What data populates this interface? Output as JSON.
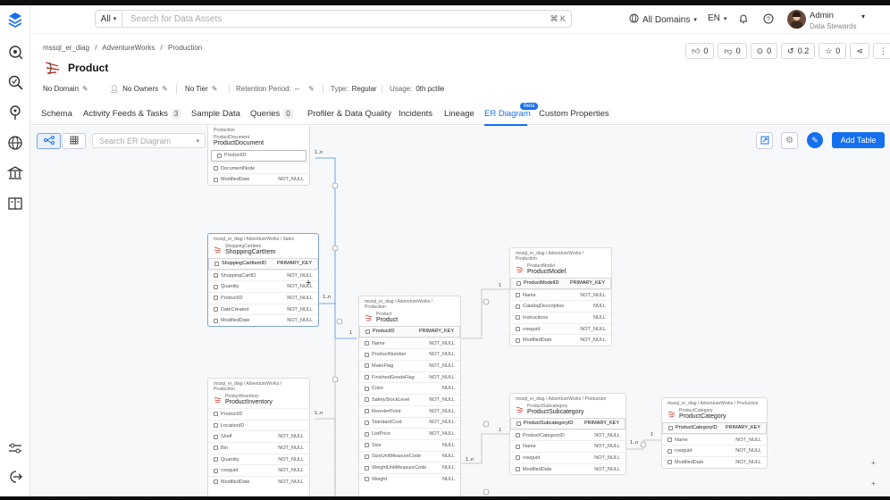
{
  "topbar": {
    "search_scope": "All",
    "search_placeholder": "Search for Data Assets",
    "shortcut": "⌘ K",
    "domain": "All Domains",
    "language": "EN",
    "user_name": "Admin",
    "user_role": "Data Stewards"
  },
  "breadcrumb": {
    "a": "mssql_er_diag",
    "sep1": "/",
    "b": "AdventureWorks",
    "sep2": "/",
    "c": "Production"
  },
  "entity": {
    "title": "Product"
  },
  "actions": {
    "thumbs_up": "0",
    "thumbs_down": "0",
    "conversations": "0",
    "version": "0.2",
    "stars": "0"
  },
  "meta": {
    "domain": "No Domain",
    "owners": "No Owners",
    "tier": "No Tier",
    "retention_label": "Retention Period:",
    "retention_value": "--",
    "type_label": "Type:",
    "type_value": "Regular",
    "usage_label": "Usage:",
    "usage_value": "0th pctile"
  },
  "tabs": [
    {
      "label": "Schema"
    },
    {
      "label": "Activity Feeds & Tasks",
      "count": "3"
    },
    {
      "label": "Sample Data"
    },
    {
      "label": "Queries",
      "count": "0"
    },
    {
      "label": "Profiler & Data Quality"
    },
    {
      "label": "Incidents"
    },
    {
      "label": "Lineage"
    },
    {
      "label": "ER Diagram",
      "badge": "Beta"
    },
    {
      "label": "Custom Properties"
    }
  ],
  "er": {
    "search_placeholder": "Search ER Diagram",
    "add_table": "Add Table"
  },
  "tables": {
    "productdocument": {
      "path": "Production",
      "small": "ProductDocument",
      "name": "ProductDocument",
      "rows": [
        {
          "name": "ProductID",
          "type": ""
        },
        {
          "name": "DocumentNode",
          "type": ""
        },
        {
          "name": "ModifiedDate",
          "type": "NOT_NULL"
        }
      ]
    },
    "shoppingcartitem": {
      "path": "mssql_er_diag / AdventureWorks / Sales",
      "small": "ShoppingCartItem",
      "name": "ShoppingCartItem",
      "rows": [
        {
          "name": "ShoppingCartItemID",
          "type": "PRIMARY_KEY"
        },
        {
          "name": "ShoppingCartID",
          "type": "NOT_NULL"
        },
        {
          "name": "Quantity",
          "type": "NOT_NULL"
        },
        {
          "name": "ProductID",
          "type": "NOT_NULL"
        },
        {
          "name": "DateCreated",
          "type": "NOT_NULL"
        },
        {
          "name": "ModifiedDate",
          "type": "NOT_NULL"
        }
      ]
    },
    "productinventory": {
      "path": "mssql_er_diag / AdventureWorks / Production",
      "small": "ProductInventory",
      "name": "ProductInventory",
      "rows": [
        {
          "name": "ProductID",
          "type": ""
        },
        {
          "name": "LocationID",
          "type": ""
        },
        {
          "name": "Shelf",
          "type": "NOT_NULL"
        },
        {
          "name": "Bin",
          "type": "NOT_NULL"
        },
        {
          "name": "Quantity",
          "type": "NOT_NULL"
        },
        {
          "name": "rowguid",
          "type": "NOT_NULL"
        },
        {
          "name": "ModifiedDate",
          "type": "NOT_NULL"
        }
      ]
    },
    "product": {
      "path": "mssql_er_diag / AdventureWorks / Production",
      "small": "Product",
      "name": "Product",
      "rows": [
        {
          "name": "ProductID",
          "type": "PRIMARY_KEY"
        },
        {
          "name": "Name",
          "type": "NOT_NULL"
        },
        {
          "name": "ProductNumber",
          "type": "NOT_NULL"
        },
        {
          "name": "MakeFlag",
          "type": "NOT_NULL"
        },
        {
          "name": "FinishedGoodsFlag",
          "type": "NOT_NULL"
        },
        {
          "name": "Color",
          "type": "NULL"
        },
        {
          "name": "SafetyStockLevel",
          "type": "NOT_NULL"
        },
        {
          "name": "ReorderPoint",
          "type": "NOT_NULL"
        },
        {
          "name": "StandardCost",
          "type": "NOT_NULL"
        },
        {
          "name": "ListPrice",
          "type": "NOT_NULL"
        },
        {
          "name": "Size",
          "type": "NULL"
        },
        {
          "name": "SizeUnitMeasureCode",
          "type": "NULL"
        },
        {
          "name": "WeightUnitMeasureCode",
          "type": "NULL"
        },
        {
          "name": "Weight",
          "type": "NULL"
        }
      ]
    },
    "productmodel": {
      "path": "mssql_er_diag / AdventureWorks / Production",
      "small": "ProductModel",
      "name": "ProductModel",
      "rows": [
        {
          "name": "ProductModelID",
          "type": "PRIMARY_KEY"
        },
        {
          "name": "Name",
          "type": "NOT_NULL"
        },
        {
          "name": "CatalogDescription",
          "type": "NULL"
        },
        {
          "name": "Instructions",
          "type": "NULL"
        },
        {
          "name": "rowguid",
          "type": "NOT_NULL"
        },
        {
          "name": "ModifiedDate",
          "type": "NOT_NULL"
        }
      ]
    },
    "productsubcategory": {
      "path": "mssql_er_diag / AdventureWorks / Production",
      "small": "ProductSubcategory",
      "name": "ProductSubcategory",
      "rows": [
        {
          "name": "ProductSubcategoryID",
          "type": "PRIMARY_KEY"
        },
        {
          "name": "ProductCategoryID",
          "type": "NOT_NULL"
        },
        {
          "name": "Name",
          "type": "NOT_NULL"
        },
        {
          "name": "rowguid",
          "type": "NOT_NULL"
        },
        {
          "name": "ModifiedDate",
          "type": "NOT_NULL"
        }
      ]
    },
    "productcategory": {
      "path": "mssql_er_diag / AdventureWorks / Production",
      "small": "ProductCategory",
      "name": "ProductCategory",
      "rows": [
        {
          "name": "ProductCategoryID",
          "type": "PRIMARY_KEY"
        },
        {
          "name": "Name",
          "type": "NOT_NULL"
        },
        {
          "name": "rowguid",
          "type": "NOT_NULL"
        },
        {
          "name": "ModifiedDate",
          "type": "NOT_NULL"
        }
      ]
    }
  },
  "edge_labels": {
    "one_to_many": "1..n",
    "one": "1"
  },
  "colors": {
    "accent": "#1570ef",
    "edge_active": "#4a90d9",
    "edge": "#b8b8b8"
  }
}
